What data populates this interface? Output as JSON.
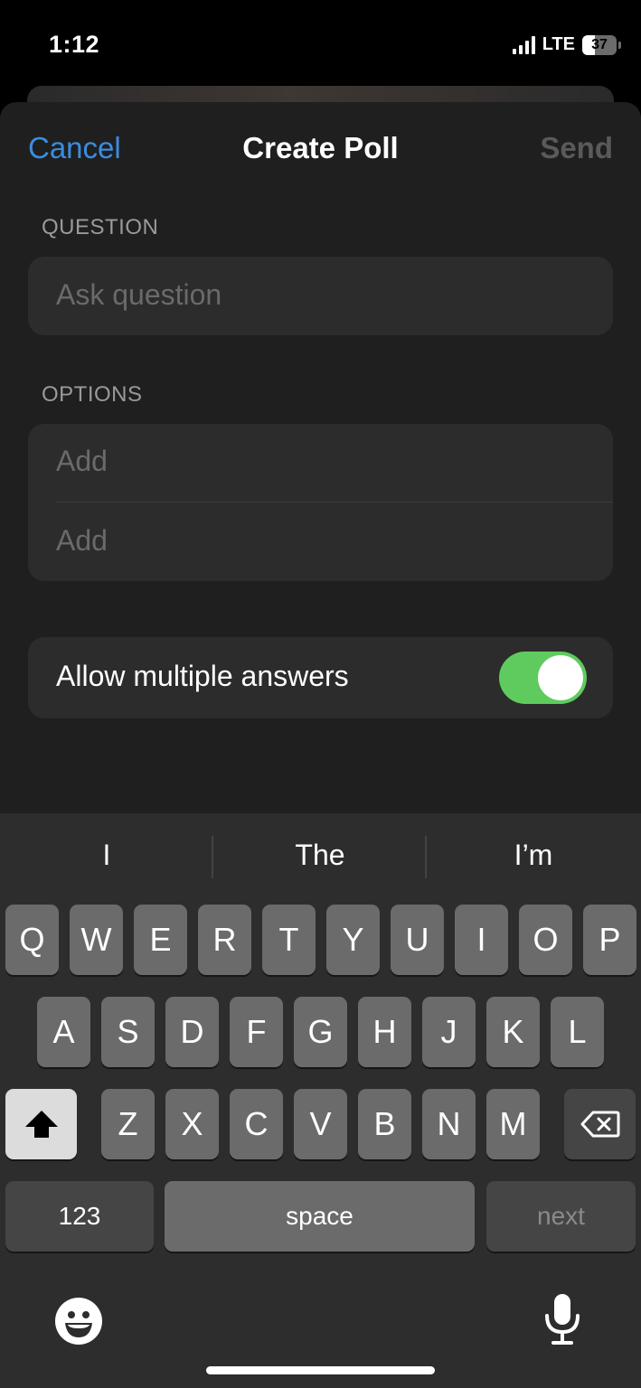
{
  "status": {
    "time": "1:12",
    "network": "LTE",
    "battery": "37"
  },
  "nav": {
    "cancel": "Cancel",
    "title": "Create Poll",
    "send": "Send"
  },
  "question": {
    "label": "QUESTION",
    "placeholder": "Ask question"
  },
  "options": {
    "label": "OPTIONS",
    "items": [
      "Add",
      "Add"
    ]
  },
  "multiple": {
    "label": "Allow multiple answers",
    "enabled": true
  },
  "keyboard": {
    "suggestions": [
      "I",
      "The",
      "I’m"
    ],
    "row1": [
      "Q",
      "W",
      "E",
      "R",
      "T",
      "Y",
      "U",
      "I",
      "O",
      "P"
    ],
    "row2": [
      "A",
      "S",
      "D",
      "F",
      "G",
      "H",
      "J",
      "K",
      "L"
    ],
    "row3": [
      "Z",
      "X",
      "C",
      "V",
      "B",
      "N",
      "M"
    ],
    "numbers": "123",
    "space": "space",
    "next": "next"
  },
  "colors": {
    "accent": "#3a8ddf",
    "toggle_on": "#5fcb5e"
  }
}
